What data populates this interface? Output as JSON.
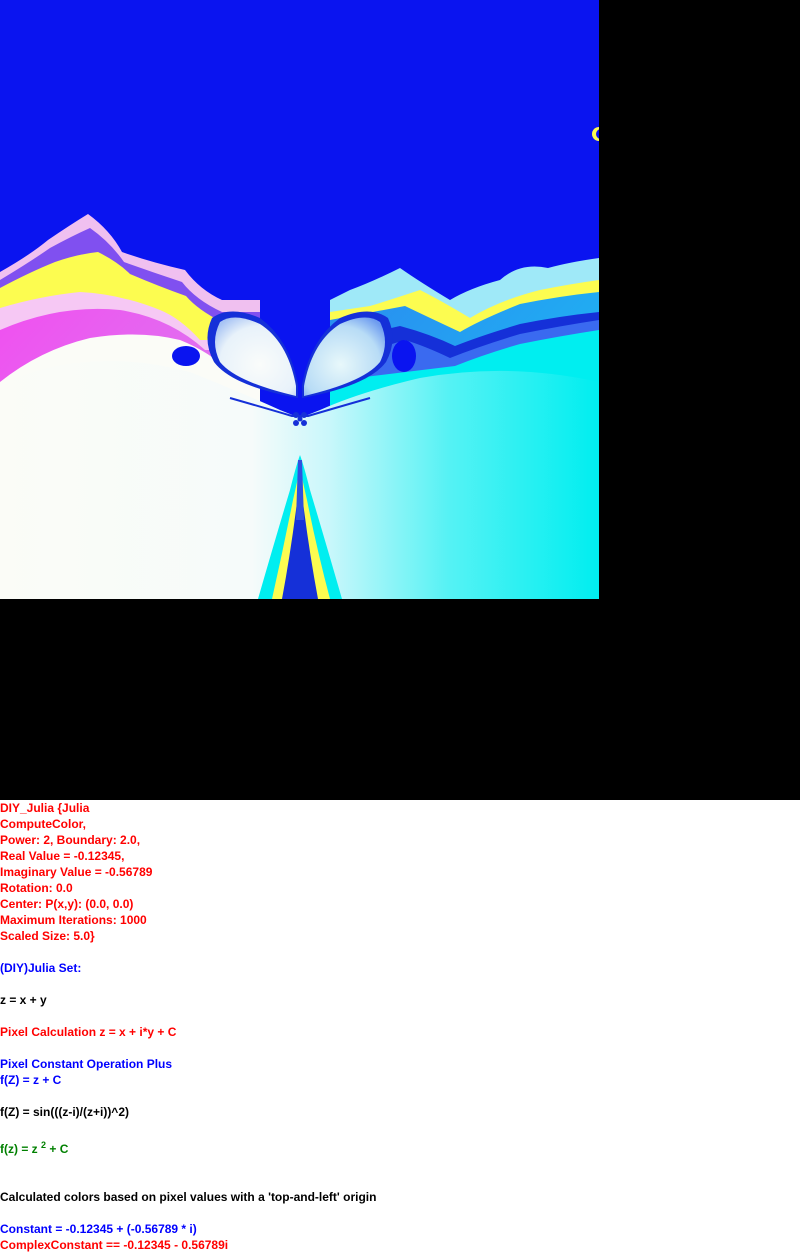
{
  "fractal": {
    "colors": {
      "background": "#000000",
      "set_blue": "#0a14f0",
      "deep_blue": "#1530d8",
      "cyan": "#00eef0",
      "white": "#fafcf8",
      "yellow": "#fcfc50",
      "pink": "#f050f0",
      "light_pink": "#f0c0f0",
      "light_blue": "#a0c0f8",
      "purple": "#8050f0"
    }
  },
  "info": {
    "params": [
      "DIY_Julia {Julia",
      "ComputeColor,",
      "Power: 2, Boundary: 2.0,",
      "Real Value = -0.12345,",
      "Imaginary Value = -0.56789",
      "Rotation: 0.0",
      "Center: P(x,y): (0.0, 0.0)",
      "Maximum Iterations: 1000",
      "Scaled Size: 5.0}"
    ],
    "set_name": "(DIY)Julia Set:",
    "z_def": "z = x + y",
    "pixel_calc": "Pixel Calculation z = x + i*y + C",
    "pixel_const_op": "Pixel Constant Operation Plus",
    "f_plus": "f(Z) = z + C",
    "f_sin": "f(Z) = sin(((z-i)/(z+i))^2)",
    "f_power": {
      "prefix": "f(z) = z",
      "exponent": "2",
      "suffix": "+ C"
    },
    "origin_note": "Calculated colors based on pixel values with a 'top-and-left' origin",
    "constant": "Constant = -0.12345 + (-0.56789 * i)",
    "complex_constant": "ComplexConstant == -0.12345 - 0.56789i"
  }
}
